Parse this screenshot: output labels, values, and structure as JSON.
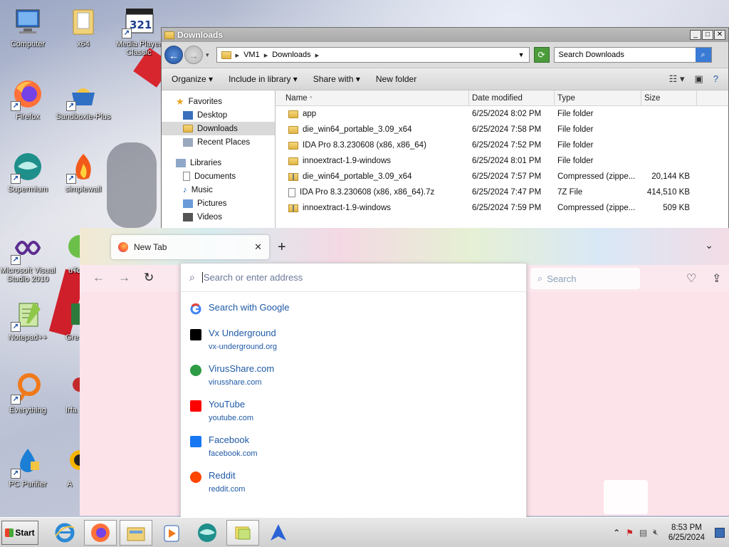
{
  "desktop": {
    "icons": [
      {
        "label": "Computer"
      },
      {
        "label": "x64"
      },
      {
        "label": "Media Player Classic"
      },
      {
        "label": "Firefox"
      },
      {
        "label": "Sandboxie-Plus"
      },
      {
        "label": "Supermium"
      },
      {
        "label": "simplewall"
      },
      {
        "label": "Microsoft Visual Studio 2010"
      },
      {
        "label": "uTo"
      },
      {
        "label": "Notepad++"
      },
      {
        "label": "Gre"
      },
      {
        "label": "Everything"
      },
      {
        "label": "Irfa"
      },
      {
        "label": "PC Purifier"
      },
      {
        "label": "A"
      }
    ]
  },
  "explorer": {
    "title": "Downloads",
    "breadcrumb": [
      "VM1",
      "Downloads"
    ],
    "search_placeholder": "Search Downloads",
    "toolbar": {
      "organize": "Organize",
      "include_in_library": "Include in library",
      "share_with": "Share with",
      "new_folder": "New folder"
    },
    "nav": {
      "favorites": "Favorites",
      "desktop": "Desktop",
      "downloads": "Downloads",
      "recent_places": "Recent Places",
      "libraries": "Libraries",
      "documents": "Documents",
      "music": "Music",
      "pictures": "Pictures",
      "videos": "Videos"
    },
    "columns": {
      "name": "Name",
      "date_modified": "Date modified",
      "type": "Type",
      "size": "Size"
    },
    "files": [
      {
        "name": "app",
        "date": "6/25/2024 8:02 PM",
        "type": "File folder",
        "size": "",
        "kind": "folder"
      },
      {
        "name": "die_win64_portable_3.09_x64",
        "date": "6/25/2024 7:58 PM",
        "type": "File folder",
        "size": "",
        "kind": "folder"
      },
      {
        "name": "IDA Pro 8.3.230608 (x86, x86_64)",
        "date": "6/25/2024 7:52 PM",
        "type": "File folder",
        "size": "",
        "kind": "folder"
      },
      {
        "name": "innoextract-1.9-windows",
        "date": "6/25/2024 8:01 PM",
        "type": "File folder",
        "size": "",
        "kind": "folder"
      },
      {
        "name": "die_win64_portable_3.09_x64",
        "date": "6/25/2024 7:57 PM",
        "type": "Compressed (zippe...",
        "size": "20,144 KB",
        "kind": "zip"
      },
      {
        "name": "IDA Pro 8.3.230608 (x86, x86_64).7z",
        "date": "6/25/2024 7:47 PM",
        "type": "7Z File",
        "size": "414,510 KB",
        "kind": "file"
      },
      {
        "name": "innoextract-1.9-windows",
        "date": "6/25/2024 7:59 PM",
        "type": "Compressed (zippe...",
        "size": "509 KB",
        "kind": "zip"
      }
    ]
  },
  "firefox": {
    "tab_title": "New Tab",
    "url_placeholder": "Search or enter address",
    "search_placeholder": "Search",
    "suggestions": {
      "google": "Search with Google",
      "sites": [
        {
          "title": "Vx Underground",
          "url": "vx-underground.org",
          "color": "#000000"
        },
        {
          "title": "VirusShare.com",
          "url": "virusshare.com",
          "color": "#2e9b45"
        },
        {
          "title": "YouTube",
          "url": "youtube.com",
          "color": "#ff0000"
        },
        {
          "title": "Facebook",
          "url": "facebook.com",
          "color": "#1877f2"
        },
        {
          "title": "Reddit",
          "url": "reddit.com",
          "color": "#ff4500"
        }
      ]
    }
  },
  "taskbar": {
    "start": "Start",
    "time": "8:53 PM",
    "date": "6/25/2024"
  }
}
